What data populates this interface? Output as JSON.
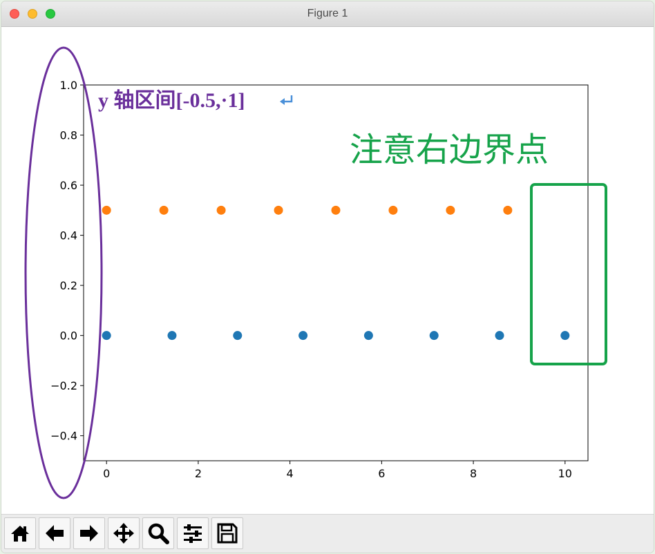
{
  "window": {
    "title": "Figure 1"
  },
  "toolbar": {
    "tools": [
      {
        "name": "home-button",
        "icon": "home-icon"
      },
      {
        "name": "back-button",
        "icon": "arrow-left-icon"
      },
      {
        "name": "forward-button",
        "icon": "arrow-right-icon"
      },
      {
        "name": "pan-button",
        "icon": "move-icon"
      },
      {
        "name": "zoom-button",
        "icon": "magnifier-icon"
      },
      {
        "name": "configure-subplots-button",
        "icon": "sliders-icon"
      },
      {
        "name": "save-button",
        "icon": "floppy-disk-icon"
      }
    ]
  },
  "annotations": {
    "y_range_note": "y 轴区间[-0.5,·1]",
    "y_range_note_color": "#6a2f9b",
    "right_boundary_note": "注意右边界点",
    "right_boundary_note_color": "#16a34a",
    "ellipse_color": "#6a2f9b",
    "box_color": "#16a34a",
    "return_mark_color": "#4a90d9"
  },
  "chart_data": {
    "type": "scatter",
    "xlim": [
      -0.5,
      10.5
    ],
    "ylim": [
      -0.5,
      1.0
    ],
    "xticks": [
      0,
      2,
      4,
      6,
      8,
      10
    ],
    "yticks": [
      -0.4,
      -0.2,
      0.0,
      0.2,
      0.4,
      0.6,
      0.8,
      1.0
    ],
    "xtick_labels": [
      "0",
      "2",
      "4",
      "6",
      "8",
      "10"
    ],
    "ytick_labels": [
      "−0.4",
      "−0.2",
      "0.0",
      "0.2",
      "0.4",
      "0.6",
      "0.8",
      "1.0"
    ],
    "grid": false,
    "series": [
      {
        "color": "#1f77b4",
        "x": [
          0,
          1.4286,
          2.8571,
          4.2857,
          5.7143,
          7.1429,
          8.5714,
          10
        ],
        "y": [
          0,
          0,
          0,
          0,
          0,
          0,
          0,
          0
        ]
      },
      {
        "color": "#ff7f0e",
        "x": [
          0,
          1.25,
          2.5,
          3.75,
          5,
          6.25,
          7.5,
          8.75
        ],
        "y": [
          0.5,
          0.5,
          0.5,
          0.5,
          0.5,
          0.5,
          0.5,
          0.5
        ]
      }
    ]
  }
}
